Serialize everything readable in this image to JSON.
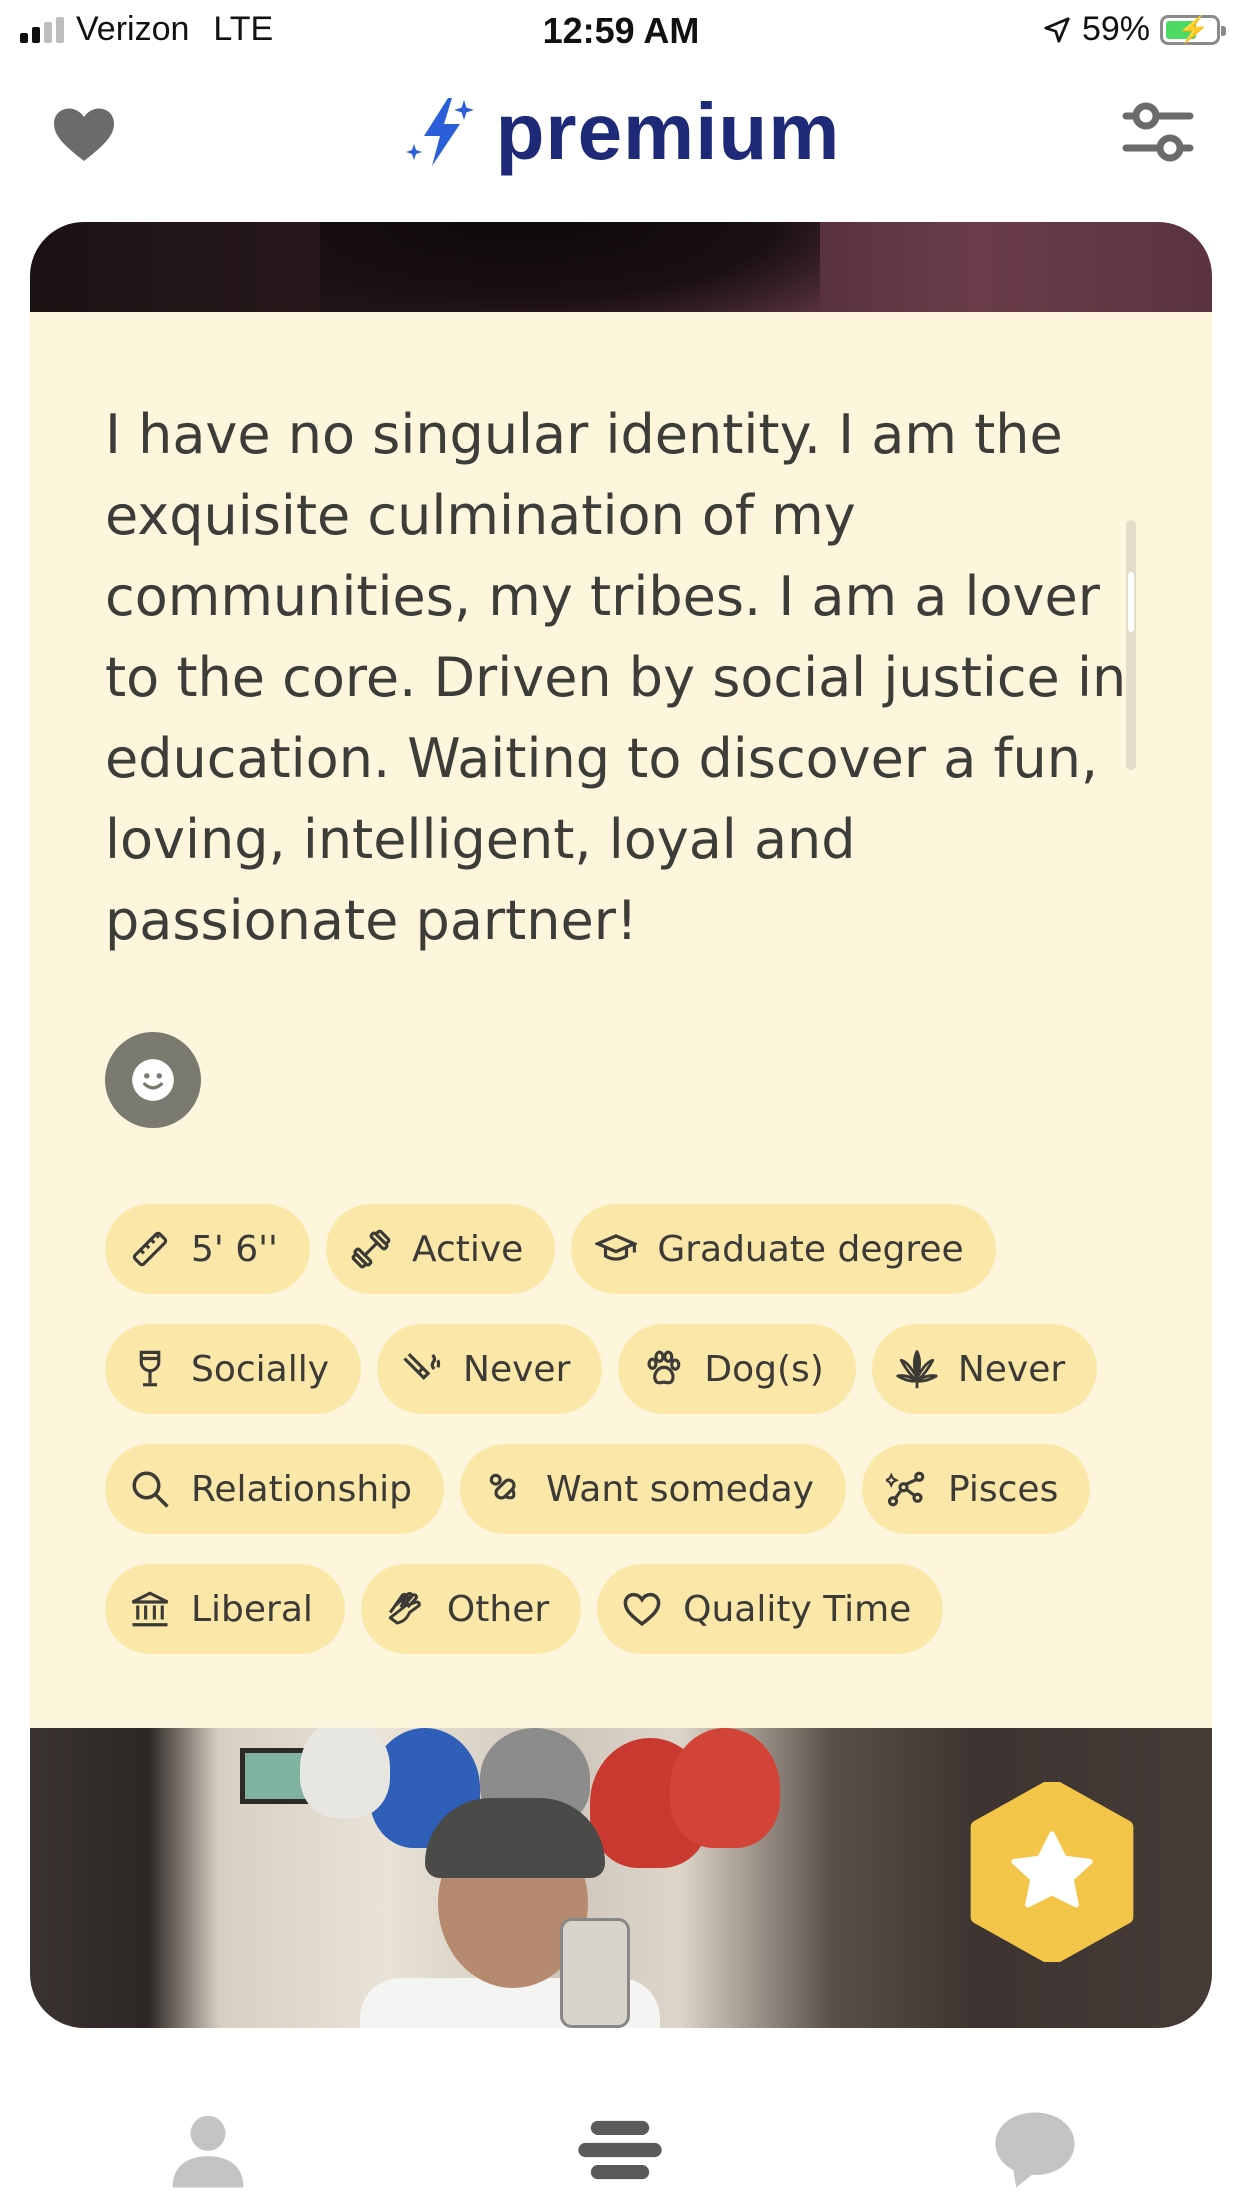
{
  "status_bar": {
    "carrier": "Verizon",
    "network": "LTE",
    "time": "12:59 AM",
    "battery_percent": "59%",
    "signal_bars": 2
  },
  "header": {
    "brand": "premium",
    "icons": {
      "left": "heart-icon",
      "brand_mark": "sparkle-bolt-icon",
      "right": "filter-sliders-icon"
    }
  },
  "profile": {
    "bio": "I have no singular identity. I am the exquisite culmination of my communities, my tribes. I am a lover to the core. Driven by social justice in education. Waiting to discover a fun, loving, intelligent, loyal and passionate partner!",
    "reaction_icon": "smiley-icon",
    "chips": [
      [
        {
          "icon": "ruler-icon",
          "label": "5' 6''"
        },
        {
          "icon": "dumbbell-icon",
          "label": "Active"
        },
        {
          "icon": "graduation-cap-icon",
          "label": "Graduate degree"
        }
      ],
      [
        {
          "icon": "wine-glass-icon",
          "label": "Socially"
        },
        {
          "icon": "cigarette-icon",
          "label": "Never"
        },
        {
          "icon": "paw-icon",
          "label": "Dog(s)"
        },
        {
          "icon": "cannabis-leaf-icon",
          "label": "Never"
        }
      ],
      [
        {
          "icon": "search-icon",
          "label": "Relationship"
        },
        {
          "icon": "pacifier-icon",
          "label": "Want someday"
        },
        {
          "icon": "constellation-icon",
          "label": "Pisces"
        }
      ],
      [
        {
          "icon": "government-building-icon",
          "label": "Liberal"
        },
        {
          "icon": "praying-hands-icon",
          "label": "Other"
        },
        {
          "icon": "heart-outline-icon",
          "label": "Quality Time"
        }
      ]
    ],
    "superlike_icon": "star-icon"
  },
  "colors": {
    "brand": "#1e2a78",
    "card_bg": "#fdf6dc",
    "chip_bg": "#fbe8a8",
    "superlike": "#f3c64a",
    "nav_icon": "#c4c4c4",
    "nav_active": "#5a5a5a"
  },
  "bottom_nav": [
    {
      "icon": "person-icon",
      "active": false
    },
    {
      "icon": "stack-icon",
      "active": true
    },
    {
      "icon": "chat-bubble-icon",
      "active": false
    }
  ]
}
